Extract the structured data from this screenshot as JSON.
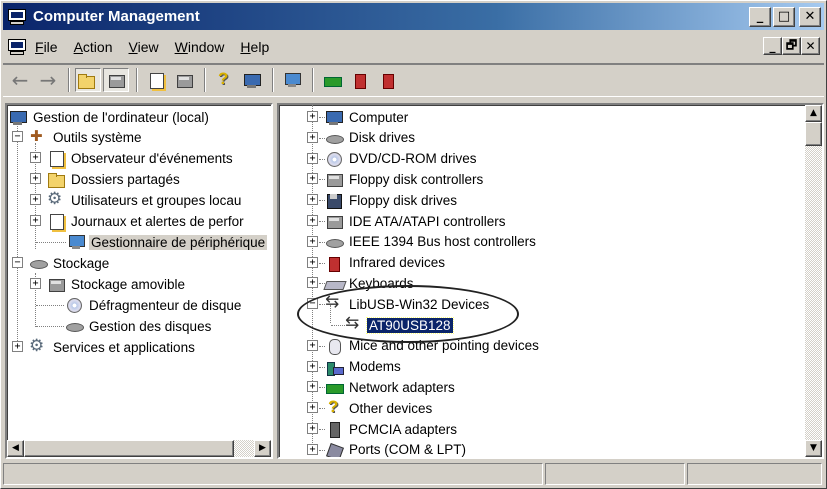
{
  "window": {
    "title": "Computer Management",
    "caption_buttons": [
      "_",
      "□",
      "✕"
    ],
    "mdi_buttons": [
      "_",
      "🗗",
      "✕"
    ]
  },
  "menu": [
    {
      "label": "File",
      "accel": "F",
      "rest": "ile"
    },
    {
      "label": "Action",
      "accel": "A",
      "rest": "ction"
    },
    {
      "label": "View",
      "accel": "V",
      "rest": "iew"
    },
    {
      "label": "Window",
      "accel": "W",
      "rest": "indow"
    },
    {
      "label": "Help",
      "accel": "H",
      "rest": "elp"
    }
  ],
  "toolbar": {
    "back_icon": "←",
    "forward_icon": "→",
    "icons": [
      "up-folder-icon",
      "show-tree-icon",
      "properties-icon",
      "print-icon",
      "help-icon",
      "console-icon",
      "scan-hardware-icon",
      "disable-icon",
      "uninstall-icon",
      "update-driver-icon"
    ]
  },
  "left_tree": [
    {
      "label": "Gestion de l'ordinateur (local)",
      "icon": "computer-icon",
      "level": 0,
      "expander": ""
    },
    {
      "label": "Outils système",
      "icon": "tools-icon",
      "level": 1,
      "expander": "−"
    },
    {
      "label": "Observateur d'événements",
      "icon": "event-viewer-icon",
      "level": 2,
      "expander": "+"
    },
    {
      "label": "Dossiers partagés",
      "icon": "folder-icon",
      "level": 2,
      "expander": "+"
    },
    {
      "label": "Utilisateurs et groupes locau",
      "icon": "users-icon",
      "level": 2,
      "expander": "+"
    },
    {
      "label": "Journaux et alertes de perfor",
      "icon": "log-icon",
      "level": 2,
      "expander": "+"
    },
    {
      "label": "Gestionnaire de périphérique",
      "icon": "device-manager-icon",
      "level": 2,
      "expander": "",
      "selected": true
    },
    {
      "label": "Stockage",
      "icon": "storage-icon",
      "level": 1,
      "expander": "−"
    },
    {
      "label": "Stockage amovible",
      "icon": "removable-storage-icon",
      "level": 2,
      "expander": "+"
    },
    {
      "label": "Défragmenteur de disque",
      "icon": "defrag-icon",
      "level": 2,
      "expander": ""
    },
    {
      "label": "Gestion des disques",
      "icon": "disk-management-icon",
      "level": 2,
      "expander": ""
    },
    {
      "label": "Services et applications",
      "icon": "services-icon",
      "level": 1,
      "expander": "+"
    }
  ],
  "right_tree": [
    {
      "label": "Computer",
      "icon": "comp",
      "expander": "+"
    },
    {
      "label": "Disk drives",
      "icon": "disk",
      "expander": "+"
    },
    {
      "label": "DVD/CD-ROM drives",
      "icon": "cd",
      "expander": "+"
    },
    {
      "label": "Floppy disk controllers",
      "icon": "box",
      "expander": "+"
    },
    {
      "label": "Floppy disk drives",
      "icon": "floppy",
      "expander": "+"
    },
    {
      "label": "IDE ATA/ATAPI controllers",
      "icon": "box",
      "expander": "+"
    },
    {
      "label": "IEEE 1394 Bus host controllers",
      "icon": "disk",
      "expander": "+"
    },
    {
      "label": "Infrared devices",
      "icon": "red",
      "expander": "+"
    },
    {
      "label": "Keyboards",
      "icon": "keyboard",
      "expander": "+"
    },
    {
      "label": "LibUSB-Win32 Devices",
      "icon": "usb",
      "expander": "−"
    },
    {
      "label": "AT90USB128",
      "icon": "usb",
      "expander": "",
      "child": true,
      "selected": true
    },
    {
      "label": "Mice and other pointing devices",
      "icon": "mouse",
      "expander": "+"
    },
    {
      "label": "Modems",
      "icon": "modem",
      "expander": "+"
    },
    {
      "label": "Network adapters",
      "icon": "net",
      "expander": "+"
    },
    {
      "label": "Other devices",
      "icon": "question",
      "expander": "+"
    },
    {
      "label": "PCMCIA adapters",
      "icon": "pcmcia",
      "expander": "+"
    },
    {
      "label": "Ports (COM & LPT)",
      "icon": "port",
      "expander": "+"
    }
  ],
  "scroll": {
    "up": "▲",
    "down": "▼",
    "left": "◀",
    "right": "▶"
  }
}
